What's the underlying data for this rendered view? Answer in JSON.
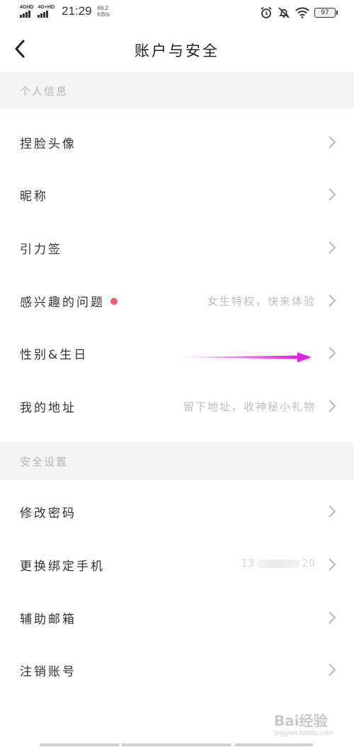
{
  "status_bar": {
    "net1": "4GHD",
    "net2": "4G+HD",
    "time": "21:29",
    "speed_value": "66.2",
    "speed_unit": "KB/s",
    "battery": "97"
  },
  "header": {
    "title": "账户与安全"
  },
  "personal": {
    "header": "个人信息",
    "rows": [
      {
        "label": "捏脸头像",
        "hint": ""
      },
      {
        "label": "昵称",
        "hint": ""
      },
      {
        "label": "引力签",
        "hint": ""
      },
      {
        "label": "感兴趣的问题",
        "hint": "女生特权，快来体验"
      },
      {
        "label": "性别&生日",
        "hint": ""
      },
      {
        "label": "我的地址",
        "hint": "留下地址，收神秘小礼物"
      }
    ]
  },
  "security": {
    "header": "安全设置",
    "rows": [
      {
        "label": "修改密码",
        "hint": ""
      },
      {
        "label": "更换绑定手机",
        "phone_prefix": "13",
        "phone_suffix": "20"
      },
      {
        "label": "辅助邮箱",
        "hint": ""
      },
      {
        "label": "注销账号",
        "hint": ""
      }
    ]
  },
  "watermark": {
    "text": "Bai经验",
    "sub": "jingyan.baidu.com"
  },
  "colors": {
    "accent_dot": "#f06070",
    "annotation_arrow": "#e020e0",
    "section_bg": "#f4f4f4"
  }
}
